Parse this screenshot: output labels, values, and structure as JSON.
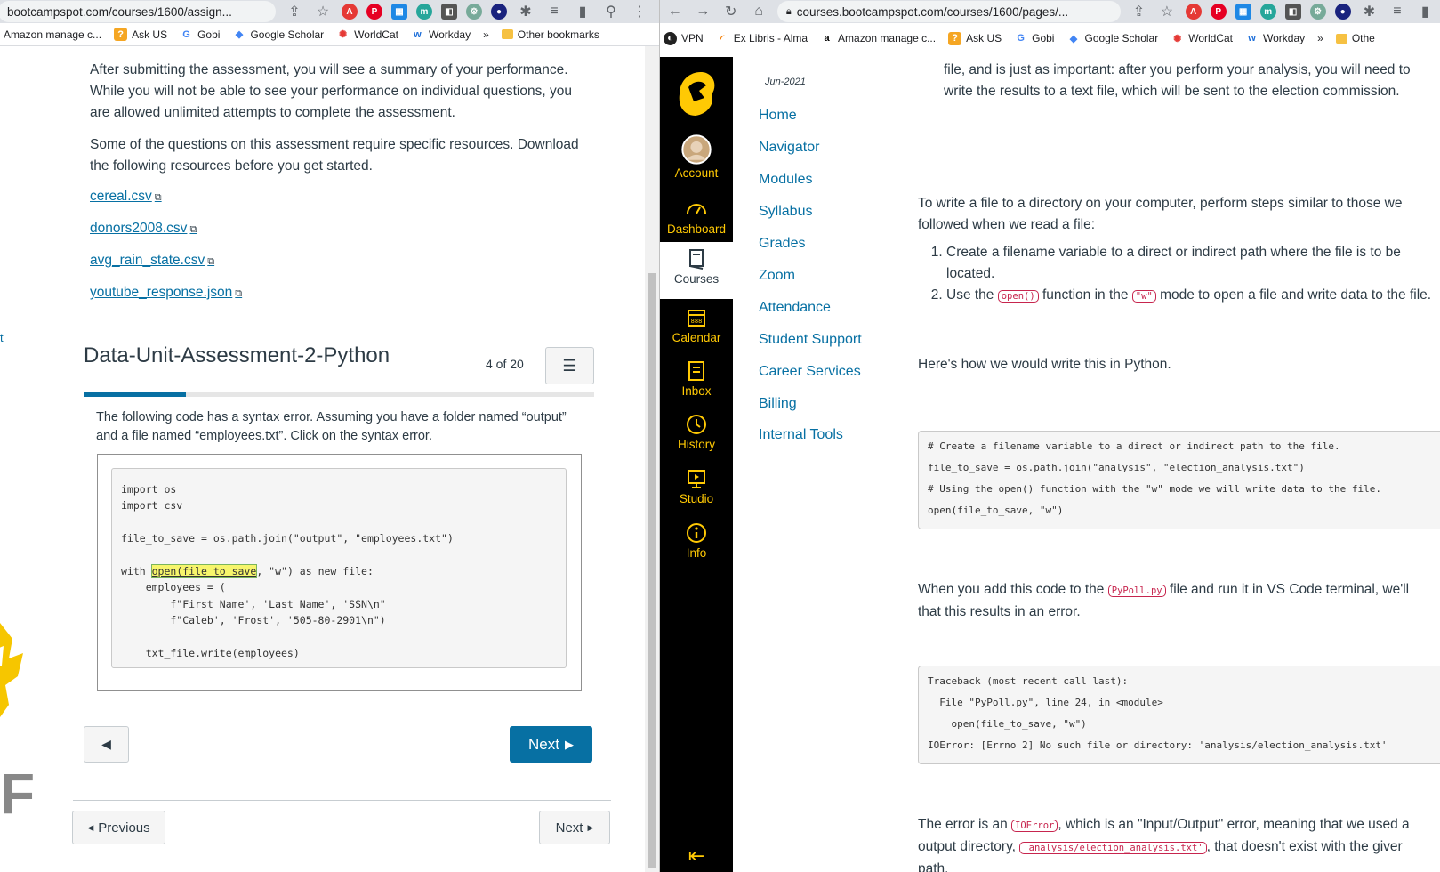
{
  "left_window": {
    "url_path": "bootcampspot.com/courses/1600/assign...",
    "bookmarks": [
      "Amazon manage c...",
      "Ask US",
      "Gobi",
      "Google Scholar",
      "WorldCat",
      "Workday",
      "»",
      "Other bookmarks"
    ],
    "intro_paragraph_1": "After submitting the assessment, you will see a summary of your performance. While you will not be able to see your performance on individual questions, you are allowed unlimited attempts to complete the assessment.",
    "intro_paragraph_2": "Some of the questions on this assessment require specific resources. Download the following resources before you get started.",
    "resources": [
      "cereal.csv",
      "donors2008.csv",
      "avg_rain_state.csv",
      "youtube_response.json"
    ],
    "edge_char": "t",
    "quiz": {
      "title": "Data-Unit-Assessment-2-Python",
      "counter": "4 of 20",
      "progress_fraction": 0.2,
      "question": "The  following code has a syntax error. Assuming you have a folder named “output” and a file named “employees.txt”. Click on the syntax error.",
      "code_lines": [
        "import os",
        "import csv",
        "",
        "file_to_save = os.path.join(\"output\", \"employees.txt\")",
        "",
        "with |open(file_to_save|, \"w\") as new_file:",
        "    employees = (",
        "        f\"First Name', 'Last Name', 'SSN\\n\"",
        "        f\"Caleb', 'Frost', '505-80-2901\\n\")",
        "",
        "    txt_file.write(employees)"
      ],
      "next_label": "Next"
    },
    "footer": {
      "previous_label": "Previous",
      "next_label": "Next"
    },
    "logo_letter": "F"
  },
  "right_window": {
    "url": "courses.bootcampspot.com/courses/1600/pages/...",
    "bookmarks": [
      "VPN",
      "Ex Libris - Alma",
      "Amazon manage c...",
      "Ask US",
      "Gobi",
      "Google Scholar",
      "WorldCat",
      "Workday",
      "»",
      "Othe"
    ],
    "global_nav": [
      "Account",
      "Dashboard",
      "Courses",
      "Calendar",
      "Inbox",
      "History",
      "Studio",
      "Info"
    ],
    "term": "Jun-2021",
    "course_nav": [
      "Home",
      "Navigator",
      "Modules",
      "Syllabus",
      "Grades",
      "Zoom",
      "Attendance",
      "Student Support",
      "Career Services",
      "Billing",
      "Internal Tools"
    ],
    "top_text": "file, and is just as important: after you perform your analysis, you will need to write the results to a text file, which will be sent to the election commission.",
    "write_intro": "To write a file to a directory on your computer, perform steps similar to those we followed when we read a file:",
    "steps": [
      {
        "text": "Create a filename variable to a direct or indirect path where the file is to be located."
      },
      {
        "pre": "Use the ",
        "code1": "open()",
        "mid": " function in the ",
        "code2": "\"w\"",
        "post": " mode to open a file and write data to the file."
      }
    ],
    "howto": "Here's how we would write this in Python.",
    "code_block_1": [
      "# Create a filename variable to a direct or indirect path to the file.",
      "file_to_save = os.path.join(\"analysis\", \"election_analysis.txt\")",
      "# Using the open() function with the \"w\" mode we will write data to the file.",
      "open(file_to_save, \"w\")"
    ],
    "when_text": {
      "pre": "When you add this code to the ",
      "code": "PyPoll.py",
      "post": " file and run it in VS Code terminal, we'll",
      "line2": "that this results in an error."
    },
    "code_block_2": [
      "Traceback (most recent call last):",
      "  File \"PyPoll.py\", line 24, in <module>",
      "    open(file_to_save, \"w\")",
      "IOError: [Errno 2] No such file or directory: 'analysis/election_analysis.txt'"
    ],
    "error_text": {
      "pre": "The error is an ",
      "code1": "IOError",
      "mid": ", which is an \"Input/Output\" error, meaning that we used a",
      "pre2": "output directory, ",
      "code2": "'analysis/election_analysis.txt'",
      "post2": ", that doesn't exist with the giver",
      "line3": "path."
    }
  },
  "colors": {
    "link": "#0770a3",
    "gold": "#ffc904",
    "nav_bg": "#000000"
  }
}
